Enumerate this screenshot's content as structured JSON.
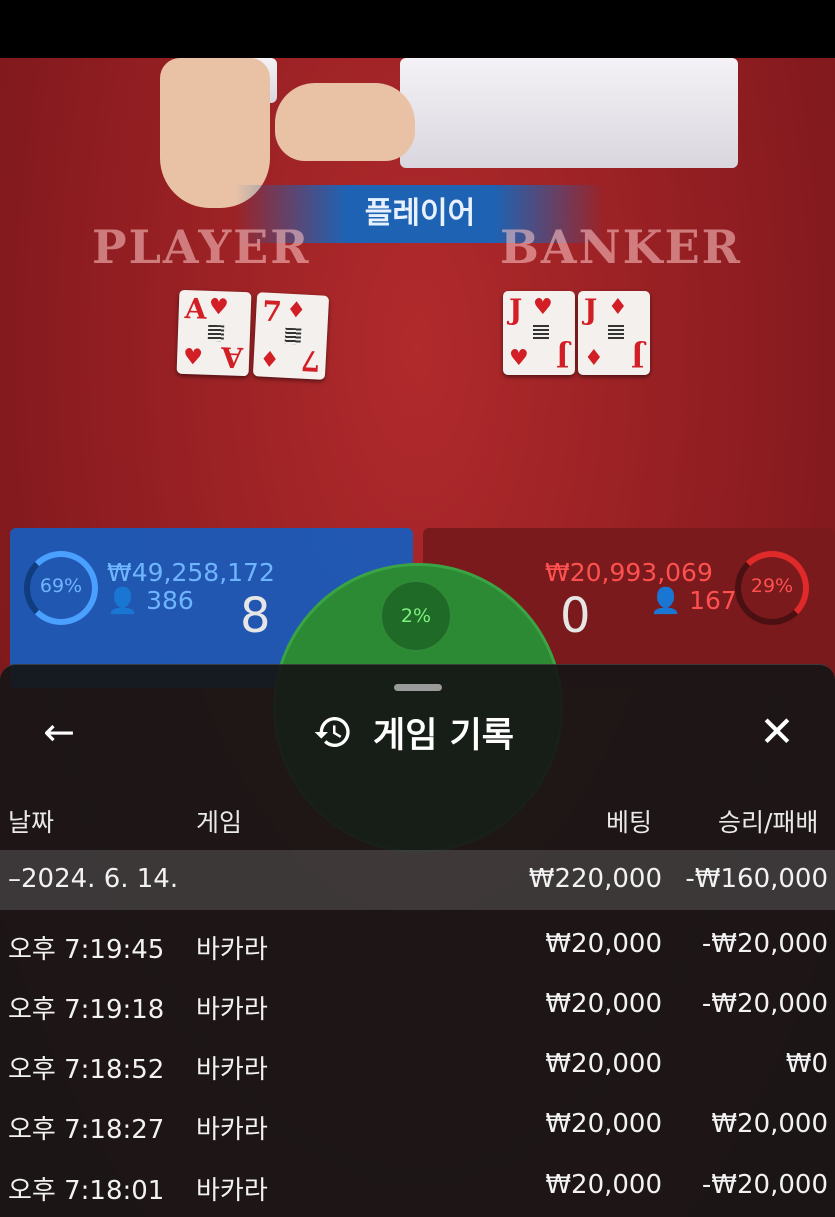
{
  "table": {
    "result_banner": "플레이어",
    "player_label": "PLAYER",
    "banker_label": "BANKER",
    "player_cards": [
      {
        "rank": "A",
        "suit": "♥"
      },
      {
        "rank": "7",
        "suit": "♦"
      }
    ],
    "banker_cards": [
      {
        "rank": "J",
        "suit": "♥"
      },
      {
        "rank": "J",
        "suit": "♦"
      }
    ],
    "player_panel": {
      "percent": "69%",
      "amount": "₩49,258,172",
      "bettors": "386",
      "score": "8"
    },
    "banker_panel": {
      "percent": "29%",
      "amount": "₩20,993,069",
      "bettors": "167",
      "score": "0"
    },
    "tie_percent": "2%",
    "colors": {
      "player": "#1a5bb8",
      "banker": "#7a1a1c",
      "tie": "#2b8a33"
    }
  },
  "sheet": {
    "title": "게임 기록",
    "back_icon": "arrow-left-icon",
    "history_icon": "history-icon",
    "close_icon": "close-icon",
    "columns": {
      "date": "날짜",
      "game": "게임",
      "bet": "베팅",
      "result": "승리/패배"
    },
    "date_group": {
      "label": "–2024. 6. 14.",
      "bet_total": "₩220,000",
      "result_total": "-₩160,000"
    },
    "rows": [
      {
        "time": "오후 7:19:45",
        "game": "바카라",
        "bet": "₩20,000",
        "result": "-₩20,000"
      },
      {
        "time": "오후 7:19:18",
        "game": "바카라",
        "bet": "₩20,000",
        "result": "-₩20,000"
      },
      {
        "time": "오후 7:18:52",
        "game": "바카라",
        "bet": "₩20,000",
        "result": "₩0"
      },
      {
        "time": "오후 7:18:27",
        "game": "바카라",
        "bet": "₩20,000",
        "result": "₩20,000"
      },
      {
        "time": "오후 7:18:01",
        "game": "바카라",
        "bet": "₩20,000",
        "result": "-₩20,000"
      }
    ]
  }
}
